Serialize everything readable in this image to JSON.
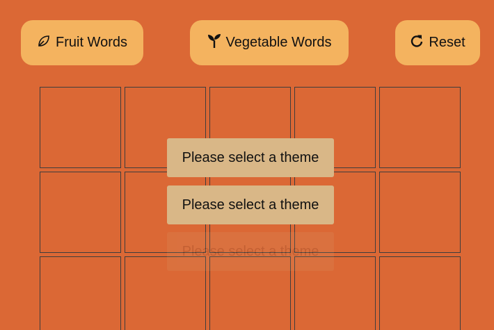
{
  "toolbar": {
    "fruit_label": "Fruit Words",
    "fruit_icon": "leaf-icon",
    "vegetable_label": "Vegetable Words",
    "vegetable_icon": "seedling-icon",
    "reset_label": "Reset",
    "reset_icon": "redo-icon"
  },
  "board": {
    "rows": 3,
    "columns": 5,
    "visible_rows_note_count": 15
  },
  "toasts": [
    {
      "message": "Please select a theme"
    },
    {
      "message": "Please select a theme"
    },
    {
      "message": "Please select a theme"
    }
  ],
  "colors": {
    "background": "#db6835",
    "button": "#f4b35f",
    "toast": "#d9b787",
    "cell_border": "#3d3d3d"
  }
}
